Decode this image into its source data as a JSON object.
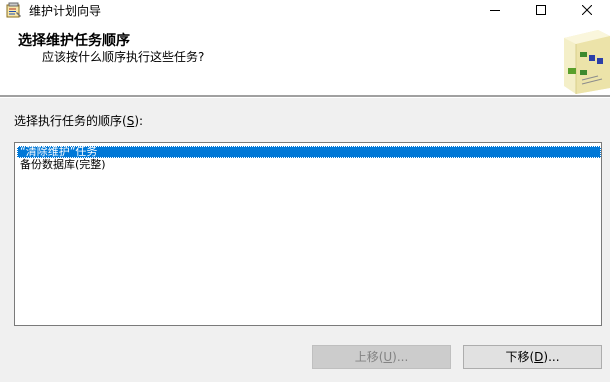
{
  "window": {
    "title": "维护计划向导",
    "icon": "maintenance-plan-icon",
    "minimize_icon": "minimize-icon",
    "maximize_icon": "maximize-icon",
    "close_icon": "close-icon"
  },
  "header": {
    "title": "选择维护任务顺序",
    "subtitle": "应该按什么顺序执行这些任务?",
    "graphic": "wizard-task-graphic"
  },
  "list": {
    "label_prefix": "选择执行任务的顺序(",
    "label_accel": "S",
    "label_suffix": "):",
    "items": [
      {
        "label": "“清除维护”任务",
        "selected": true
      },
      {
        "label": "备份数据库(完整)",
        "selected": false
      }
    ]
  },
  "buttons": {
    "move_up": {
      "prefix": "上移(",
      "accel": "U",
      "suffix": ")...",
      "enabled": false
    },
    "move_down": {
      "prefix": "下移(",
      "accel": "D",
      "suffix": ")...",
      "enabled": true
    }
  },
  "colors": {
    "selection": "#0078d7",
    "background": "#f0f0f0",
    "header_background": "#ffffff"
  }
}
